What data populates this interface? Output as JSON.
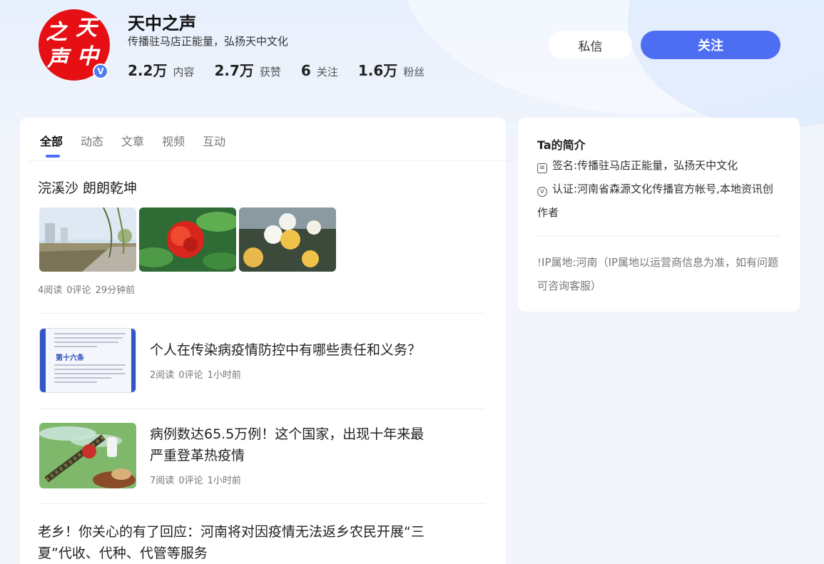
{
  "profile": {
    "name": "天中之声",
    "bio": "传播驻马店正能量，弘扬天中文化",
    "avatar_chars": [
      "天",
      "之",
      "中",
      "声"
    ],
    "verified_mark": "V",
    "stats": [
      {
        "num": "2.2万",
        "label": "内容"
      },
      {
        "num": "2.7万",
        "label": "获赞"
      },
      {
        "num": "6",
        "label": "关注"
      },
      {
        "num": "1.6万",
        "label": "粉丝"
      }
    ]
  },
  "actions": {
    "message_label": "私信",
    "follow_label": "关注"
  },
  "tabs": [
    {
      "label": "全部",
      "active": true
    },
    {
      "label": "动态",
      "active": false
    },
    {
      "label": "文章",
      "active": false
    },
    {
      "label": "视频",
      "active": false
    },
    {
      "label": "互动",
      "active": false
    }
  ],
  "posts": [
    {
      "title": "浣溪沙 朗朗乾坤",
      "reads": "4阅读",
      "comments": "0评论",
      "time": "29分钟前"
    },
    {
      "title": "个人在传染病疫情防控中有哪些责任和义务？",
      "reads": "2阅读",
      "comments": "0评论",
      "time": "1小时前",
      "thumb_heading": "第十六条"
    },
    {
      "title_line1": "病例数达65.5万例！这个国家，出现十年来最",
      "title_line2": "严重登革热疫情",
      "reads": "7阅读",
      "comments": "0评论",
      "time": "1小时前"
    },
    {
      "title_line1": "老乡！你关心的有了回应：河南将对因疫情无法返乡农民开展“三",
      "title_line2": "夏”代收、代种、代管等服务"
    }
  ],
  "intro": {
    "title": "Ta的简介",
    "signature_label": "签名:",
    "signature": "传播驻马店正能量，弘扬天中文化",
    "cert_label": "认证:",
    "cert": "河南省森源文化传播官方帐号,本地资讯创作者",
    "ip_label": "IP属地:",
    "ip": "河南（IP属地以运营商信息为准，如有问题可咨询客服）"
  },
  "colors": {
    "accent": "#4d6ef3",
    "avatar_red": "#e50f14"
  },
  "icons": [
    "verified-icon",
    "signature-icon",
    "certification-icon",
    "info-icon"
  ]
}
